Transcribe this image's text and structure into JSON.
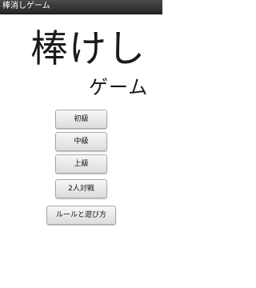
{
  "app": {
    "title": "棒消しゲーム"
  },
  "logo": {
    "main": "棒けし",
    "sub": "ゲーム"
  },
  "menu": {
    "buttons": [
      {
        "label": "初級"
      },
      {
        "label": "中級"
      },
      {
        "label": "上級"
      },
      {
        "label": "2人対戦"
      },
      {
        "label": "ルールと遊び方"
      }
    ]
  }
}
